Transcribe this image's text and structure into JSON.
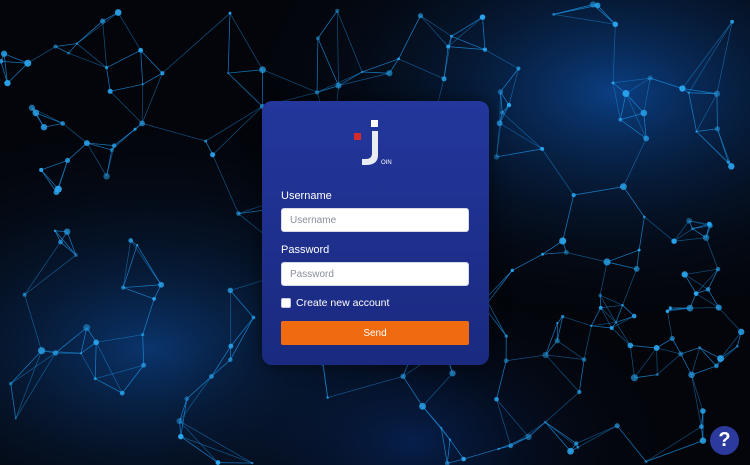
{
  "login": {
    "username_label": "Username",
    "username_placeholder": "Username",
    "password_label": "Password",
    "password_placeholder": "Password",
    "create_account_label": "Create new account",
    "send_label": "Send"
  },
  "logo": {
    "letter": "J",
    "suffix": "OIN"
  },
  "help": {
    "label": "?"
  },
  "colors": {
    "card": "#23379c",
    "button": "#f06a0f",
    "logo_accent": "#d42a2a",
    "network_line": "#1b8fe0"
  }
}
